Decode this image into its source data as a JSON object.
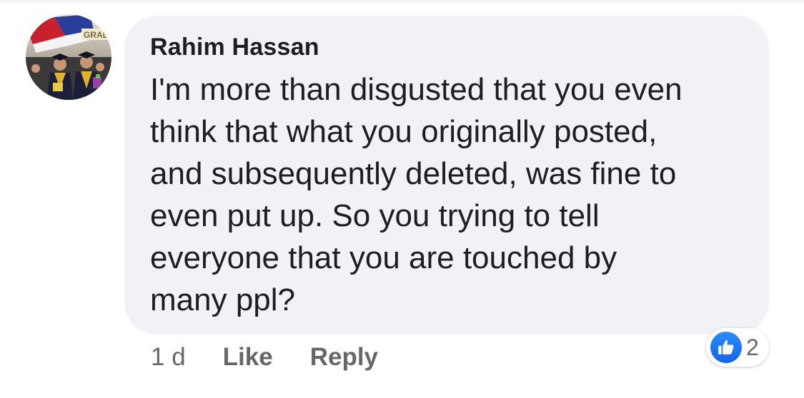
{
  "comment": {
    "author": "Rahim Hassan",
    "text": "I'm more than disgusted that you even\nthink that what you originally posted,\nand subsequently deleted, was fine to\neven put up. So you trying to tell\neveryone that you are touched by\nmany ppl?",
    "timestamp": "1 d",
    "like_label": "Like",
    "reply_label": "Reply",
    "reactions": {
      "icon": "thumbs-up-icon",
      "count": "2",
      "color": "#1877f2"
    },
    "avatar": {
      "icon": "profile-photo-graduation",
      "banner_text": "GRAD"
    }
  },
  "colors": {
    "bubble_background": "#f0f2f5",
    "text": "#1c1e21",
    "secondary_text": "#65676b"
  }
}
